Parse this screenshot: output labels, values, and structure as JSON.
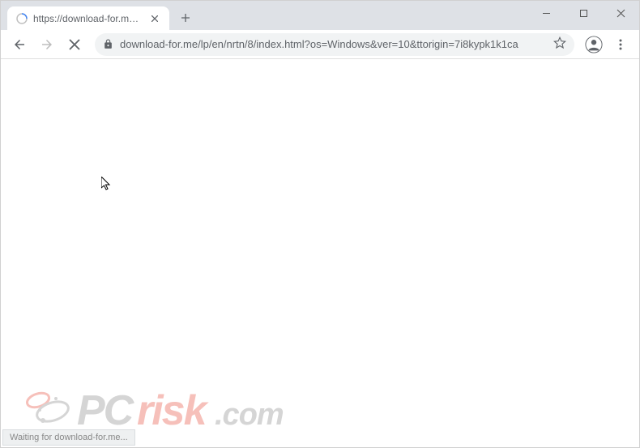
{
  "window": {
    "controls": {
      "minimize": "minimize",
      "maximize": "maximize",
      "close": "close"
    }
  },
  "tab": {
    "title": "https://download-for.me/lp/en/n",
    "loading": true
  },
  "toolbar": {
    "back": "Back",
    "forward": "Forward",
    "stop": "Stop loading",
    "url": "download-for.me/lp/en/nrtn/8/index.html?os=Windows&ver=10&ttorigin=7i8kypk1k1ca",
    "bookmark": "Bookmark this page",
    "menu": "Customize and control"
  },
  "status": {
    "text": "Waiting for download-for.me..."
  },
  "watermark": {
    "text_pc": "PC",
    "text_risk": "risk",
    "text_com": ".com"
  }
}
